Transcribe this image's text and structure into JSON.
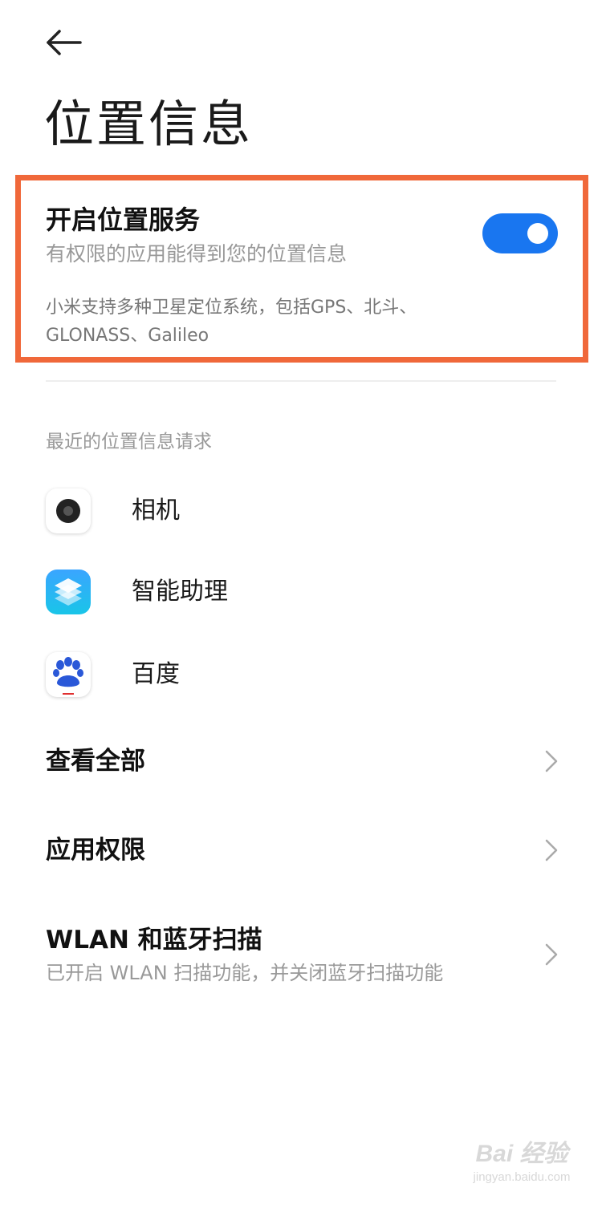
{
  "header": {
    "title": "位置信息"
  },
  "location_service": {
    "title": "开启位置服务",
    "subtitle": "有权限的应用能得到您的位置信息",
    "enabled": true,
    "note": "小米支持多种卫星定位系统，包括GPS、北斗、GLONASS、Galileo",
    "highlight_color": "#f0683a",
    "toggle_color": "#1976f0"
  },
  "recent_requests": {
    "header": "最近的位置信息请求",
    "apps": [
      {
        "name": "相机",
        "icon": "camera-icon"
      },
      {
        "name": "智能助理",
        "icon": "smart-assistant-icon"
      },
      {
        "name": "百度",
        "icon": "baidu-icon"
      }
    ]
  },
  "menu": {
    "view_all": "查看全部",
    "app_permissions": "应用权限",
    "scan_title": "WLAN 和蓝牙扫描",
    "scan_sub": "已开启 WLAN 扫描功能，并关闭蓝牙扫描功能"
  },
  "watermark": {
    "main": "Bai 经验",
    "sub": "jingyan.baidu.com"
  }
}
